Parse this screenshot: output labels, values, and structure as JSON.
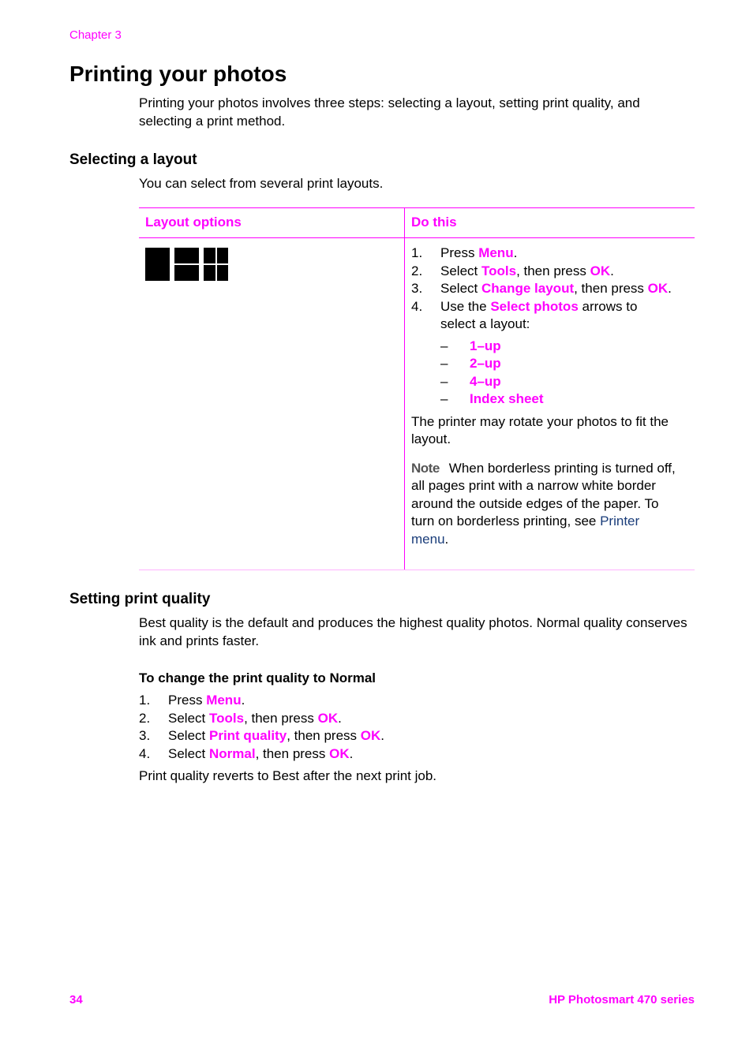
{
  "header": {
    "chapter": "Chapter 3"
  },
  "title": "Printing your photos",
  "intro": "Printing your photos involves three steps: selecting a layout, setting print quality, and selecting a print method.",
  "layout_section": {
    "heading": "Selecting a layout",
    "text": "You can select from several print layouts.",
    "table": {
      "col1": "Layout options",
      "col2": "Do this",
      "icons": [
        "layout-1up-icon",
        "layout-2up-icon",
        "layout-4up-icon"
      ],
      "steps": [
        {
          "num": "1.",
          "pre": "Press ",
          "hl": "Menu",
          "mid": ".",
          "hl2": "",
          "post": ""
        },
        {
          "num": "2.",
          "pre": "Select ",
          "hl": "Tools",
          "mid": ", then press ",
          "hl2": "OK",
          "post": "."
        },
        {
          "num": "3.",
          "pre": "Select ",
          "hl": "Change layout",
          "mid": ", then press ",
          "hl2": "OK",
          "post": "."
        },
        {
          "num": "4.",
          "pre": "Use the ",
          "hl": "Select photos",
          "mid": " arrows to select a layout:",
          "hl2": "",
          "post": ""
        }
      ],
      "options": [
        "1–up",
        "2–up",
        "4–up",
        "Index sheet"
      ],
      "dash": "–",
      "rotate_note": "The printer may rotate your photos to fit the layout.",
      "note_label": "Note",
      "note_text": "When borderless printing is turned off, all pages print with a narrow white border around the outside edges of the paper. To turn on borderless printing, see ",
      "note_link": "Printer menu",
      "note_end": "."
    }
  },
  "quality_section": {
    "heading": "Setting print quality",
    "text": "Best quality is the default and produces the highest quality photos. Normal quality conserves ink and prints faster.",
    "procedure_heading": "To change the print quality to Normal",
    "steps": [
      {
        "num": "1.",
        "pre": "Press ",
        "hl": "Menu",
        "mid": ".",
        "hl2": "",
        "post": ""
      },
      {
        "num": "2.",
        "pre": "Select ",
        "hl": "Tools",
        "mid": ", then press ",
        "hl2": "OK",
        "post": "."
      },
      {
        "num": "3.",
        "pre": "Select ",
        "hl": "Print quality",
        "mid": ", then press ",
        "hl2": "OK",
        "post": "."
      },
      {
        "num": "4.",
        "pre": "Select ",
        "hl": "Normal",
        "mid": ", then press ",
        "hl2": "OK",
        "post": "."
      }
    ],
    "after": "Print quality reverts to Best after the next print job."
  },
  "footer": {
    "page": "34",
    "product": "HP Photosmart 470 series"
  },
  "colors": {
    "accent": "#ff00ff",
    "link": "#1a3d7a"
  }
}
